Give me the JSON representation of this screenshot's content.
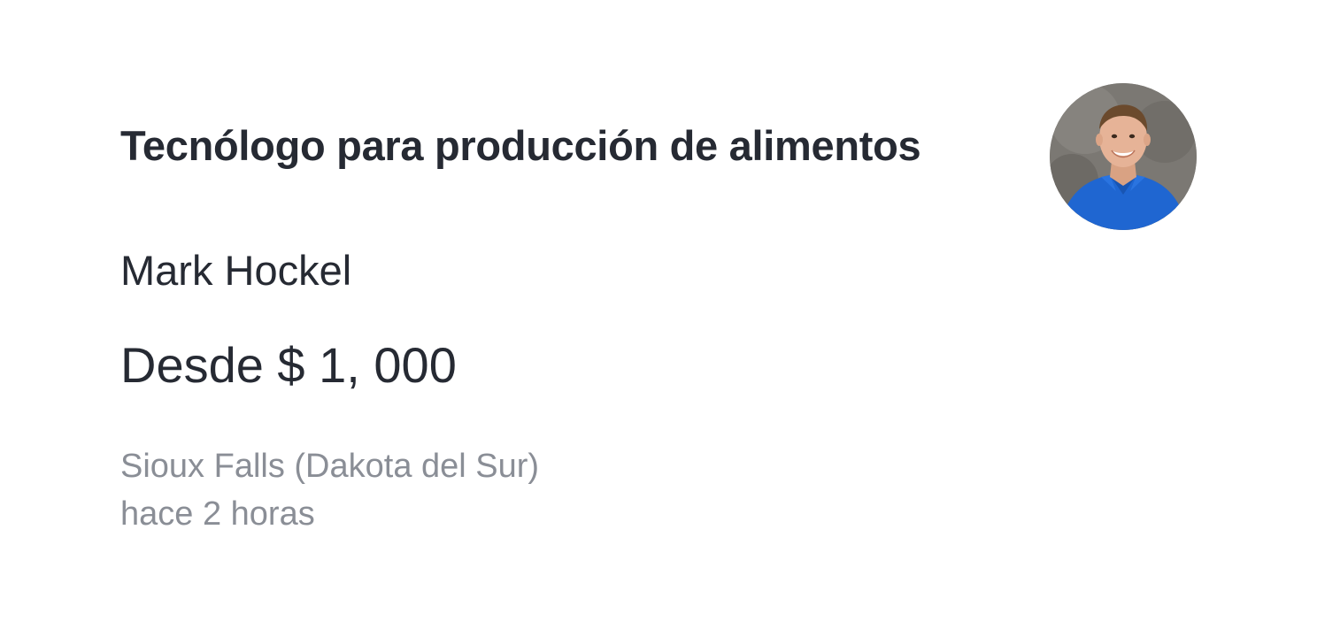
{
  "listing": {
    "title": "Tecnólogo para producción de alimentos",
    "author": "Mark Hockel",
    "price": "Desde $ 1, 000",
    "location": "Sioux Falls (Dakota del Sur)",
    "posted": "hace 2 horas"
  },
  "colors": {
    "primary_text": "#262a33",
    "secondary_text": "#8a8e96",
    "shirt_blue": "#1f66d1",
    "background": "#ffffff"
  },
  "icons": {
    "avatar": "avatar-photo-icon"
  }
}
